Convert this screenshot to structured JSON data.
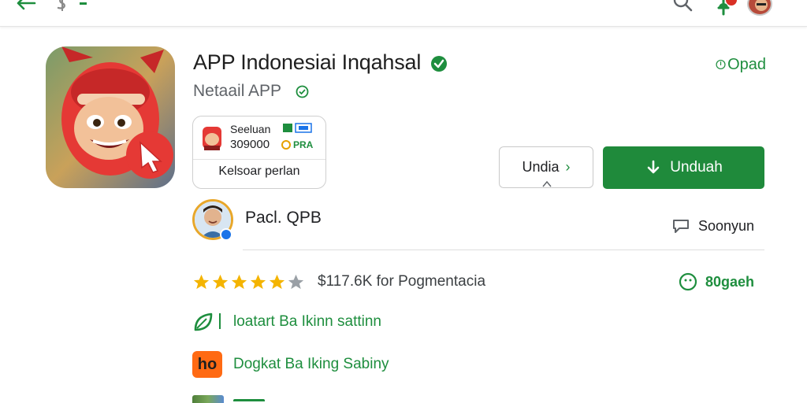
{
  "topbar": {
    "back_icon": "arrow-left",
    "brand_icon": "dollar-like-glyph",
    "search_icon": "magnifier",
    "notify_icon": "green-bell-with-badge",
    "avatar": "user-avatar"
  },
  "app": {
    "title": "APP Indonesiai Inqahsal",
    "developer": "Netaail APP",
    "icon": "red-helmet-character-with-cursor",
    "top_right_link": "Opad"
  },
  "promo": {
    "line1": "Seeluan",
    "line2": "309000",
    "chip2_text": "PRA",
    "caption": "Kelsoar perlan"
  },
  "buttons": {
    "secondary_label": "Undia",
    "secondary_chevron": "›",
    "primary_label": "Unduah"
  },
  "developer_row": {
    "name": "Pacl. QPB",
    "share_label": "Soonyun"
  },
  "rating": {
    "stars_filled": 5,
    "stars_total": 6,
    "text": "$117.6K for Pogmentacia",
    "right_text": "80gaeh"
  },
  "features": [
    {
      "icon": "green-leaf-icon",
      "label": "loatart Ba Ikinn sattinn"
    },
    {
      "icon": "orange-badge-icon",
      "badge_text": "ho",
      "label": "Dogkat Ba Iking Sabiny"
    }
  ],
  "colors": {
    "accent_green": "#1f8a3b",
    "star_gold": "#f4b400",
    "star_gray": "#9aa0a6",
    "orange": "#ff6a13"
  }
}
